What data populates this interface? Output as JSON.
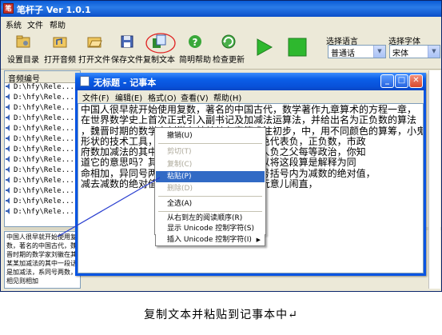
{
  "app": {
    "title": "笔杆子 Ver 1.0.1",
    "menu": [
      "系统",
      "文件",
      "帮助"
    ],
    "toolbar": [
      {
        "label": "设置目录",
        "icon": "settings-dir-icon"
      },
      {
        "label": "打开音频",
        "icon": "open-audio-icon"
      },
      {
        "label": "打开文件",
        "icon": "open-file-icon"
      },
      {
        "label": "保存文件",
        "icon": "save-file-icon"
      },
      {
        "label": "复制文本",
        "icon": "copy-text-icon"
      },
      {
        "label": "简明帮助",
        "icon": "help-icon"
      },
      {
        "label": "检查更新",
        "icon": "update-icon"
      }
    ],
    "language": {
      "label": "选择语言",
      "value": "普通话"
    },
    "font": {
      "label": "选择字体",
      "value": "宋体"
    },
    "file_list": {
      "header": "音频编号",
      "rows": [
        "D:\\hfy\\Rele...",
        "D:\\hfy\\Rele...",
        "D:\\hfy\\Rele...",
        "D:\\hfy\\Rele...",
        "D:\\hfy\\Rele...",
        "D:\\hfy\\Rele...",
        "D:\\hfy\\Rele...",
        "D:\\hfy\\Rele...",
        "D:\\hfy\\Rele...",
        "D:\\hfy\\Rele...",
        "D:\\hfy\\Rele...",
        "D:\\hfy\\Rele...",
        "D:\\hfy\\Rele..."
      ]
    },
    "lower_text": "中国人很早就开始使用复数，著名的中国古代，魏晋时期的数学家刘徽在其某某加减法的其中一段话是加减法，系同号两数，相见则相加"
  },
  "notepad": {
    "title": "无标题 - 记事本",
    "menu": [
      "文件(F)",
      "编辑(E)",
      "格式(O)",
      "查看(V)",
      "帮助(H)"
    ],
    "text_lines": [
      "中国人很早就开始使用复数，著名的中国古代，数学著作九章算术的方程一章，",
      "在世界数学史上首次正式引入副书记及加减法运算法，并给出名为正负数的算法",
      "，魏晋时期的数学家刘徽在其某某九章算术注初步，中，用不同颜色的算筹，小鬼",
      "形状的技术工具，                  代表证，黑色代表负，正负数，市政",
      "府数加减法的其中                  详细，正无人负之父每等政治，你知",
      "道它的意思吗？其                  就是威力可以将这段算是解释为同",
      "命相加，异同号两                  绝对值的符号括号内为减数的绝对值，",
      "减去减数的绝对值                  要查阅网络玩意儿闹直，"
    ]
  },
  "context_menu": {
    "items": [
      {
        "label": "撤销(U)",
        "enabled": true
      },
      {
        "label": "剪切(T)",
        "enabled": false
      },
      {
        "label": "复制(C)",
        "enabled": false
      },
      {
        "label": "粘贴(P)",
        "enabled": true,
        "selected": true
      },
      {
        "label": "删除(D)",
        "enabled": false
      },
      {
        "label": "全选(A)",
        "enabled": true
      },
      {
        "label": "从右到左的阅读顺序(R)",
        "enabled": true
      },
      {
        "label": "显示 Unicode 控制字符(S)",
        "enabled": true
      },
      {
        "label": "插入 Unicode 控制字符(I)",
        "enabled": true,
        "submenu": true
      }
    ]
  },
  "caption": "复制文本并粘贴到记事本中↵",
  "colors": {
    "title_bar": "#0a5bd6",
    "selection": "#316ac5",
    "annotation": "#e02020",
    "play_green": "#2eb82e"
  }
}
